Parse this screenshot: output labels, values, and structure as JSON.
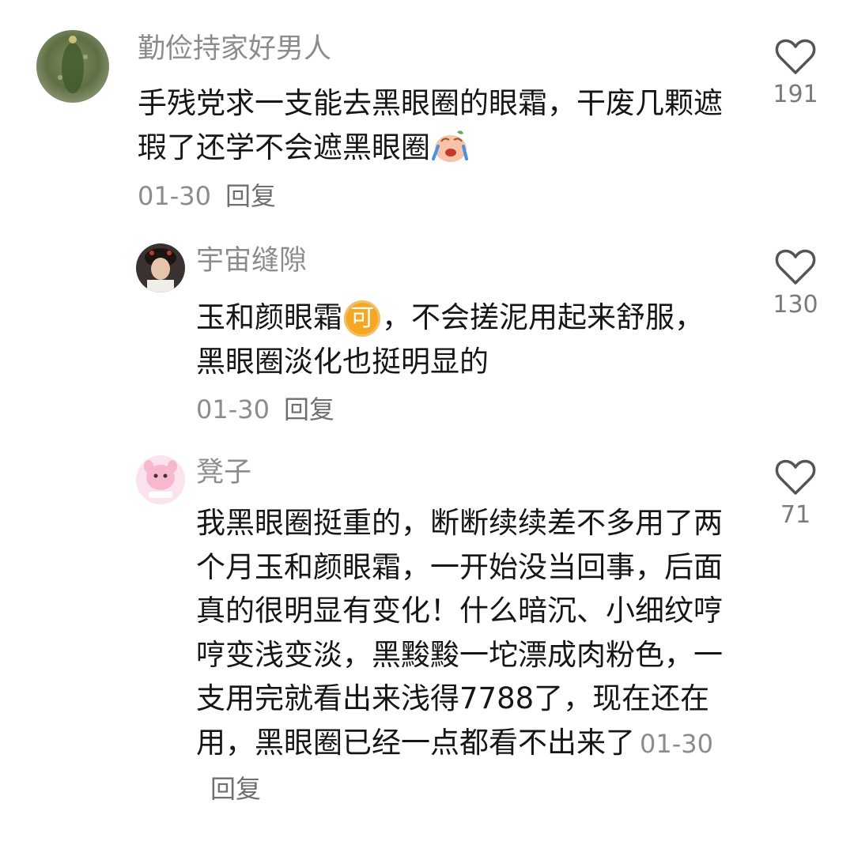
{
  "comments": [
    {
      "username": "勤俭持家好男人",
      "text": "手残党求一支能去黑眼圈的眼霜，干废几颗遮瑕了还学不会遮黑眼圈",
      "emoji": "crying-laughing-face-emoji",
      "date": "01-30",
      "reply_label": "回复",
      "likes": "191"
    },
    {
      "username": "宇宙缝隙",
      "text_before_emoji": "玉和颜眼霜",
      "emoji_label": "可",
      "text_after_emoji": "，不会搓泥用起来舒服，黑眼圈淡化也挺明显的",
      "date": "01-30",
      "reply_label": "回复",
      "likes": "130"
    },
    {
      "username": "凳子",
      "text": "我黑眼圈挺重的，断断续续差不多用了两个月玉和颜眼霜，一开始没当回事，后面真的很明显有变化！什么暗沉、小细纹哼哼变浅变淡，黑黢黢一坨漂成肉粉色，一支用完就看出来浅得7788了，现在还在用，黑眼圈已经一点都看不出来了",
      "date": "01-30",
      "reply_label": "回复",
      "likes": "71"
    }
  ],
  "colors": {
    "username": "#8c8c8c",
    "text": "#161616",
    "meta": "#8c8c8c",
    "heart_stroke": "#555555"
  }
}
